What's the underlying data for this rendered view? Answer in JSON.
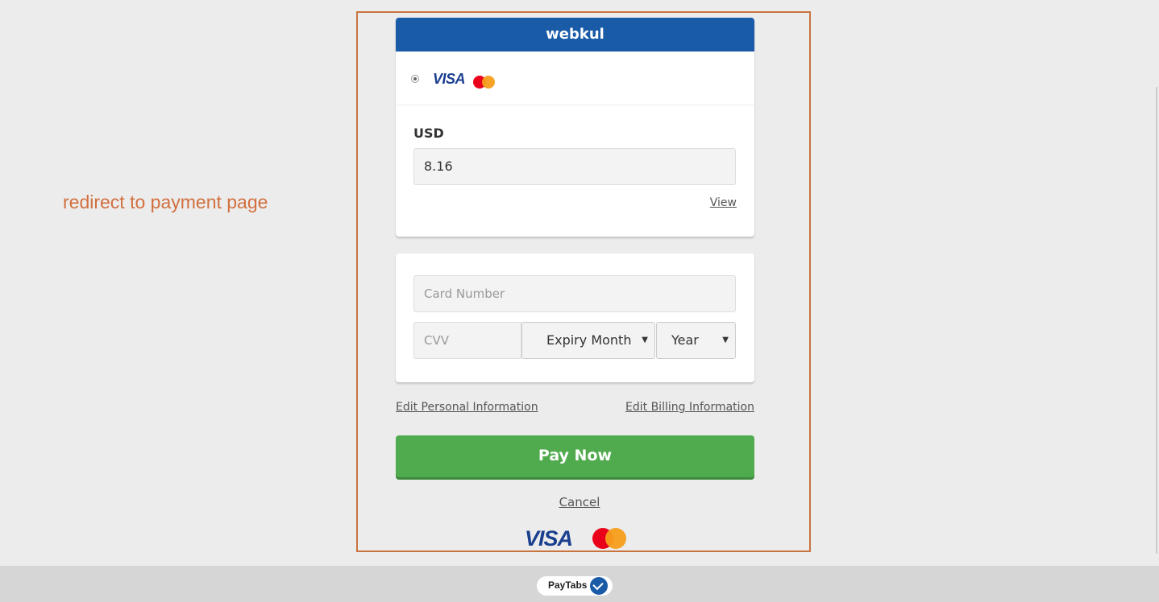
{
  "annotation": {
    "text": "redirect to payment page"
  },
  "merchant": {
    "name": "webkul"
  },
  "payment_methods": {
    "visa_label": "VISA",
    "selected": true
  },
  "amount": {
    "currency": "USD",
    "value": "8.16",
    "view_label": "View"
  },
  "card_form": {
    "card_number_placeholder": "Card Number",
    "cvv_placeholder": "CVV",
    "expiry_month": "Expiry Month",
    "expiry_year": "Year"
  },
  "links": {
    "edit_personal": "Edit Personal Information",
    "edit_billing": "Edit Billing Information",
    "cancel": "Cancel"
  },
  "pay_button": {
    "label": "Pay Now"
  },
  "footer_logos": {
    "visa_label": "VISA"
  },
  "footer": {
    "brand": "PayTabs"
  },
  "colors": {
    "header_blue": "#1a5ba8",
    "pay_green": "#50ab4f",
    "annotation_orange": "#d2703f",
    "page_background": "#ececec"
  }
}
